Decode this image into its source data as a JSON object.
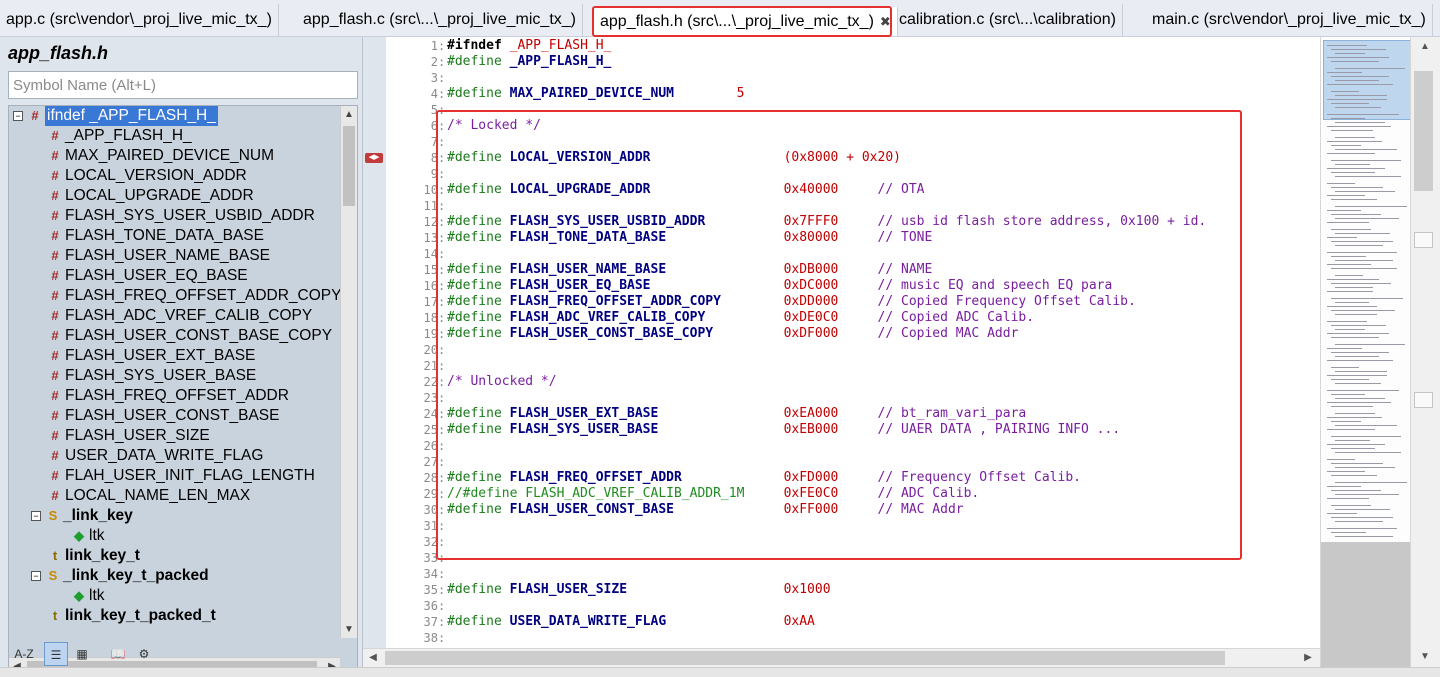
{
  "tabs": [
    {
      "label": "app.c (src\\vendor\\_proj_live_mic_tx_)",
      "active": false
    },
    {
      "label": "app_flash.c (src\\...\\_proj_live_mic_tx_)",
      "active": false
    },
    {
      "label": "app_flash.h (src\\...\\_proj_live_mic_tx_)",
      "active": true
    },
    {
      "label": "calibration.c (src\\...\\calibration)",
      "active": false
    },
    {
      "label": "main.c (src\\vendor\\_proj_live_mic_tx_)",
      "active": false
    }
  ],
  "tab_close_glyph": "✖",
  "panel": {
    "title": "app_flash.h",
    "search_placeholder": "Symbol Name (Alt+L)"
  },
  "tree": [
    {
      "label": "ifndef _APP_FLASH_H_",
      "icon": "hash",
      "expander": "−",
      "indent": 0,
      "selected": true,
      "bold": false
    },
    {
      "label": "_APP_FLASH_H_",
      "icon": "hash",
      "indent": 1
    },
    {
      "label": "MAX_PAIRED_DEVICE_NUM",
      "icon": "hash",
      "indent": 1
    },
    {
      "label": "LOCAL_VERSION_ADDR",
      "icon": "hash",
      "indent": 1
    },
    {
      "label": "LOCAL_UPGRADE_ADDR",
      "icon": "hash",
      "indent": 1
    },
    {
      "label": "FLASH_SYS_USER_USBID_ADDR",
      "icon": "hash",
      "indent": 1
    },
    {
      "label": "FLASH_TONE_DATA_BASE",
      "icon": "hash",
      "indent": 1
    },
    {
      "label": "FLASH_USER_NAME_BASE",
      "icon": "hash",
      "indent": 1
    },
    {
      "label": "FLASH_USER_EQ_BASE",
      "icon": "hash",
      "indent": 1
    },
    {
      "label": "FLASH_FREQ_OFFSET_ADDR_COPY",
      "icon": "hash",
      "indent": 1
    },
    {
      "label": "FLASH_ADC_VREF_CALIB_COPY",
      "icon": "hash",
      "indent": 1
    },
    {
      "label": "FLASH_USER_CONST_BASE_COPY",
      "icon": "hash",
      "indent": 1
    },
    {
      "label": "FLASH_USER_EXT_BASE",
      "icon": "hash",
      "indent": 1
    },
    {
      "label": "FLASH_SYS_USER_BASE",
      "icon": "hash",
      "indent": 1
    },
    {
      "label": "FLASH_FREQ_OFFSET_ADDR",
      "icon": "hash",
      "indent": 1
    },
    {
      "label": "FLASH_USER_CONST_BASE",
      "icon": "hash",
      "indent": 1
    },
    {
      "label": "FLASH_USER_SIZE",
      "icon": "hash",
      "indent": 1
    },
    {
      "label": "USER_DATA_WRITE_FLAG",
      "icon": "hash",
      "indent": 1
    },
    {
      "label": "FLAH_USER_INIT_FLAG_LENGTH",
      "icon": "hash",
      "indent": 1
    },
    {
      "label": "LOCAL_NAME_LEN_MAX",
      "icon": "hash",
      "indent": 1
    },
    {
      "label": "_link_key",
      "icon": "struct",
      "expander": "−",
      "indent": 1,
      "bold": true
    },
    {
      "label": "ltk",
      "icon": "member",
      "indent": 2
    },
    {
      "label": "link_key_t",
      "icon": "typedef",
      "indent": 1,
      "bold": true
    },
    {
      "label": "_link_key_t_packed",
      "icon": "struct",
      "expander": "−",
      "indent": 1,
      "bold": true
    },
    {
      "label": "ltk",
      "icon": "member",
      "indent": 2
    },
    {
      "label": "link_key_t_packed_t",
      "icon": "typedef",
      "indent": 1,
      "bold": true
    }
  ],
  "icon_glyphs": {
    "hash": "#",
    "struct": "S",
    "typedef": "t",
    "member": "◆"
  },
  "toolbar": [
    {
      "name": "sort-alpha-button",
      "glyph": "A-Z",
      "on": false
    },
    {
      "name": "sort-category-button",
      "glyph": "☰",
      "on": true
    },
    {
      "name": "group-type-button",
      "glyph": "▦",
      "on": false
    },
    {
      "name": "book-button",
      "glyph": "📖",
      "on": false
    },
    {
      "name": "settings-button",
      "glyph": "⚙",
      "on": false
    }
  ],
  "code_lines": [
    {
      "n": "1",
      "text": "#ifndef _APP_FLASH_H_",
      "kind": "ifndef"
    },
    {
      "n": "2",
      "text": "#define _APP_FLASH_H_",
      "kind": "define-only",
      "name": "_APP_FLASH_H_"
    },
    {
      "n": "3",
      "text": ""
    },
    {
      "n": "4",
      "kind": "def",
      "name": "MAX_PAIRED_DEVICE_NUM",
      "value": "5",
      "comment": "",
      "valcol": 37
    },
    {
      "n": "5",
      "text": ""
    },
    {
      "n": "6",
      "kind": "comment",
      "text": "/* Locked */"
    },
    {
      "n": "7",
      "text": ""
    },
    {
      "n": "8",
      "kind": "def",
      "name": "LOCAL_VERSION_ADDR",
      "value": "(0x8000 + 0x20)",
      "comment": ""
    },
    {
      "n": "9",
      "text": ""
    },
    {
      "n": "10",
      "kind": "def",
      "name": "LOCAL_UPGRADE_ADDR",
      "value": "0x40000",
      "comment": "// OTA"
    },
    {
      "n": "11",
      "text": ""
    },
    {
      "n": "12",
      "kind": "def",
      "name": "FLASH_SYS_USER_USBID_ADDR",
      "value": "0x7FFF0",
      "comment": "// usb id flash store address, 0x100 + id."
    },
    {
      "n": "13",
      "kind": "def",
      "name": "FLASH_TONE_DATA_BASE",
      "value": "0x80000",
      "comment": "// TONE"
    },
    {
      "n": "14",
      "text": ""
    },
    {
      "n": "15",
      "kind": "def",
      "name": "FLASH_USER_NAME_BASE",
      "value": "0xDB000",
      "comment": "// NAME"
    },
    {
      "n": "16",
      "kind": "def",
      "name": "FLASH_USER_EQ_BASE",
      "value": "0xDC000",
      "comment": "// music EQ and speech EQ para"
    },
    {
      "n": "17",
      "kind": "def",
      "name": "FLASH_FREQ_OFFSET_ADDR_COPY",
      "value": "0xDD000",
      "comment": "// Copied Frequency Offset Calib."
    },
    {
      "n": "18",
      "kind": "def",
      "name": "FLASH_ADC_VREF_CALIB_COPY",
      "value": "0xDE0C0",
      "comment": "// Copied ADC Calib."
    },
    {
      "n": "19",
      "kind": "def",
      "name": "FLASH_USER_CONST_BASE_COPY",
      "value": "0xDF000",
      "comment": "// Copied MAC Addr"
    },
    {
      "n": "20",
      "text": ""
    },
    {
      "n": "21",
      "text": ""
    },
    {
      "n": "22",
      "kind": "comment",
      "text": "/* Unlocked */"
    },
    {
      "n": "23",
      "text": ""
    },
    {
      "n": "24",
      "kind": "def",
      "name": "FLASH_USER_EXT_BASE",
      "value": "0xEA000",
      "comment": "// bt_ram_vari_para"
    },
    {
      "n": "25",
      "kind": "def",
      "name": "FLASH_SYS_USER_BASE",
      "value": "0xEB000",
      "comment": "// UAER DATA , PAIRING INFO ..."
    },
    {
      "n": "26",
      "text": ""
    },
    {
      "n": "27",
      "text": ""
    },
    {
      "n": "28",
      "kind": "def",
      "name": "FLASH_FREQ_OFFSET_ADDR",
      "value": "0xFD000",
      "comment": "// Frequency Offset Calib."
    },
    {
      "n": "29",
      "kind": "disabled",
      "name": "//#define FLASH_ADC_VREF_CALIB_ADDR_1M",
      "value": "0xFE0C0",
      "comment": "// ADC Calib."
    },
    {
      "n": "30",
      "kind": "def",
      "name": "FLASH_USER_CONST_BASE",
      "value": "0xFF000",
      "comment": "// MAC Addr"
    },
    {
      "n": "31",
      "text": ""
    },
    {
      "n": "32",
      "text": ""
    },
    {
      "n": "33",
      "text": ""
    },
    {
      "n": "34",
      "text": ""
    },
    {
      "n": "35",
      "kind": "def",
      "name": "FLASH_USER_SIZE",
      "value": "0x1000",
      "comment": ""
    },
    {
      "n": "36",
      "text": ""
    },
    {
      "n": "37",
      "kind": "def",
      "name": "USER_DATA_WRITE_FLAG",
      "value": "0xAA",
      "comment": ""
    },
    {
      "n": "38",
      "text": ""
    }
  ],
  "keywords": {
    "ifndef": "#ifndef",
    "define": "#define"
  },
  "ifndef_name": "_APP_FLASH_H_",
  "colors": {
    "highlight_box": "#e53030",
    "selection": "#3a78d6",
    "macro_name": "#000080",
    "value": "#c00000",
    "comment": "#7a1ea0"
  }
}
